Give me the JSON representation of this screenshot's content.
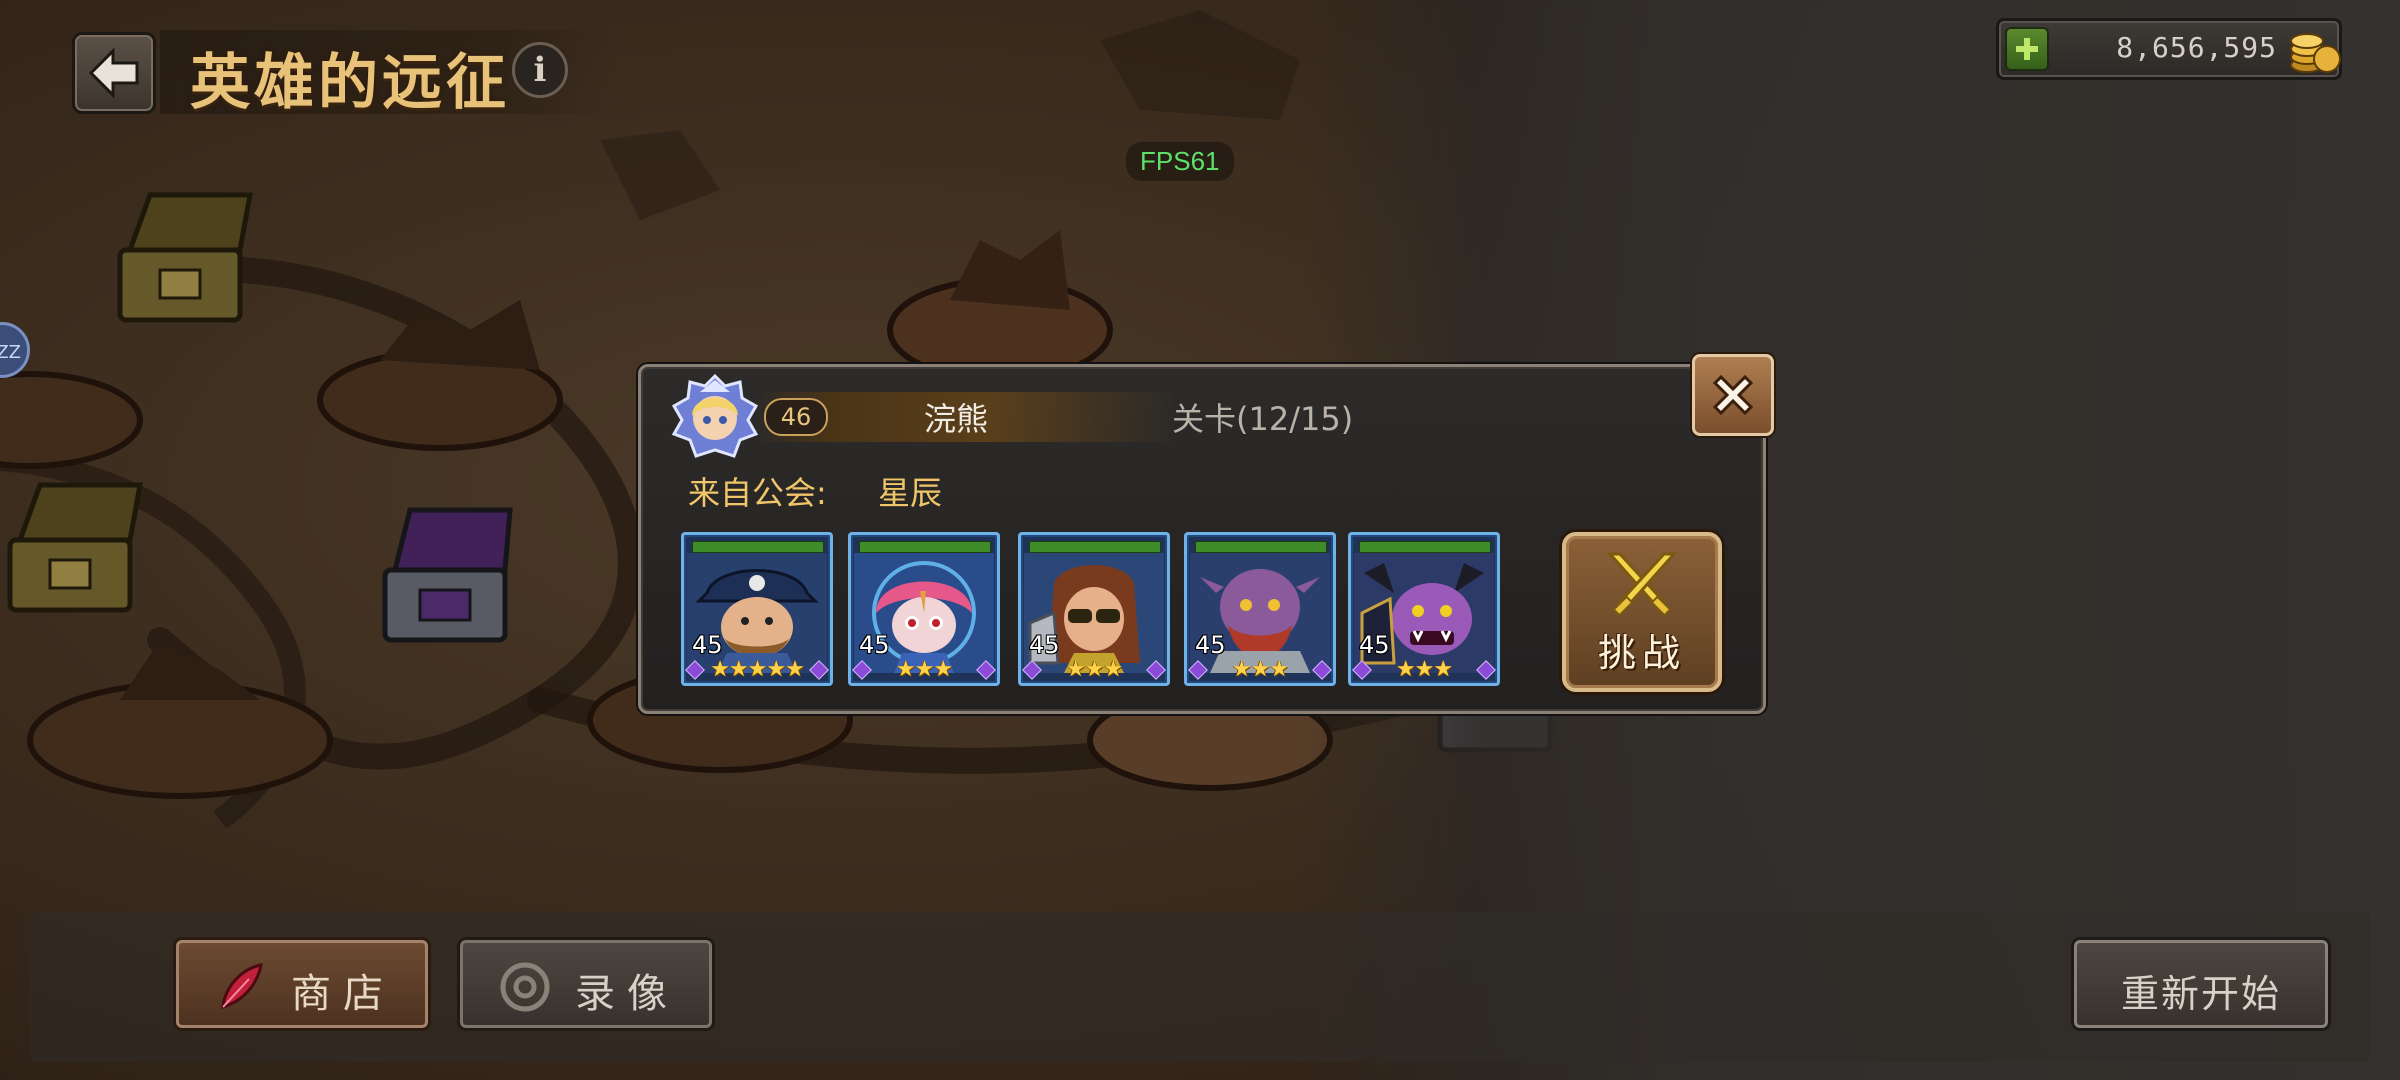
{
  "header": {
    "title": "英雄的远征",
    "gold": "8,656,595"
  },
  "fps": "FPS61",
  "side_badge": "ZZ",
  "dialog": {
    "level": "46",
    "name": "浣熊",
    "stage": "关卡(12/15)",
    "guild_prefix": "来自公会:",
    "guild_name": "星辰",
    "challenge_label": "挑战",
    "heroes": [
      {
        "level": "45",
        "stars": 5,
        "icon": "pirate-captain-hero"
      },
      {
        "level": "45",
        "stars": 3,
        "icon": "pink-hair-girl-hero"
      },
      {
        "level": "45",
        "stars": 3,
        "icon": "sunglasses-warrior-hero"
      },
      {
        "level": "45",
        "stars": 3,
        "icon": "purple-orc-hero"
      },
      {
        "level": "45",
        "stars": 3,
        "icon": "demon-beast-hero"
      }
    ]
  },
  "bottom": {
    "shop_label": "商店",
    "replay_label": "录像",
    "restart_label": "重新开始"
  }
}
